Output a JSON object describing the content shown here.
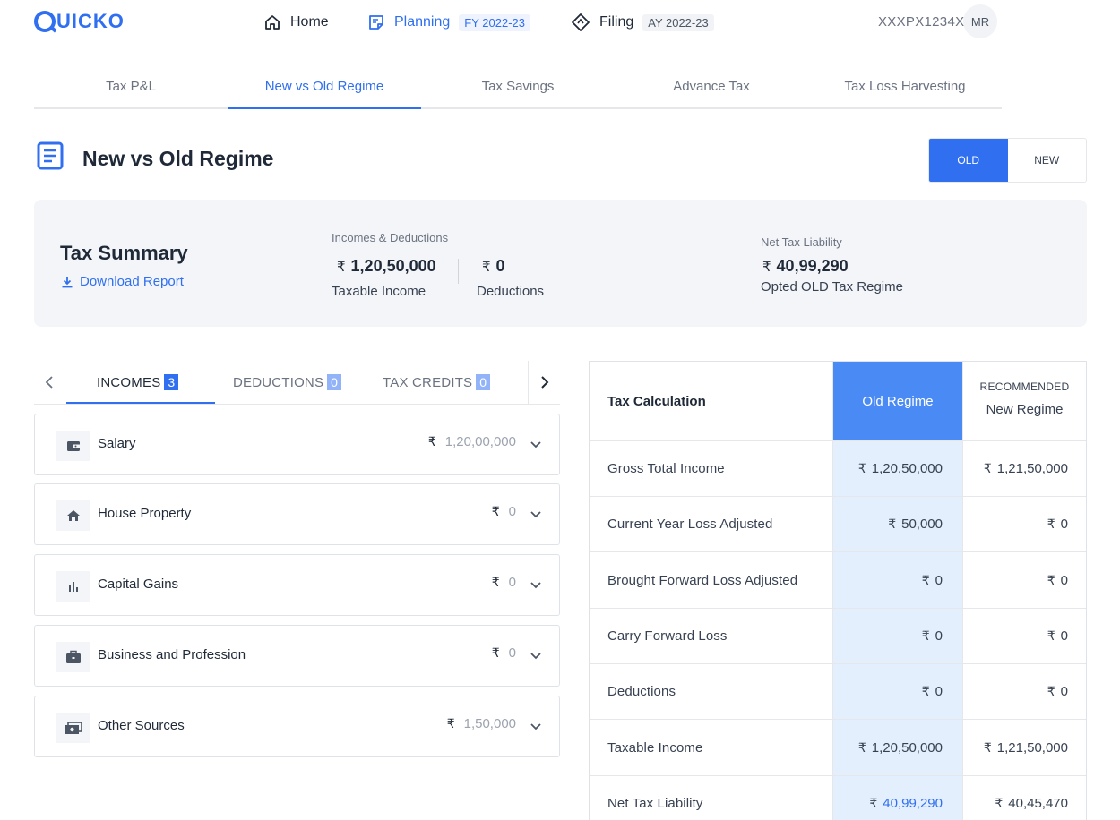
{
  "brand": {
    "logo_text": "UICKO",
    "color": "#2f6ff0"
  },
  "nav": {
    "home": {
      "label": "Home"
    },
    "planning": {
      "label": "Planning",
      "badge": "FY 2022-23"
    },
    "filing": {
      "label": "Filing",
      "badge": "AY 2022-23"
    },
    "pan": "XXXPX1234X",
    "avatar": "MR"
  },
  "top_tabs": [
    "Tax P&L",
    "New vs Old Regime",
    "Tax Savings",
    "Advance Tax",
    "Tax Loss Harvesting"
  ],
  "page": {
    "title": "New vs Old Regime",
    "toggle": {
      "old": "OLD",
      "new": "NEW",
      "selected": "OLD"
    }
  },
  "summary": {
    "title": "Tax Summary",
    "download": "Download Report",
    "incomes_label": "Incomes & Deductions",
    "currency": "₹",
    "taxable_income_value": "1,20,50,000",
    "taxable_income_label": "Taxable Income",
    "deductions_value": "0",
    "deductions_label": "Deductions",
    "liability_label": "Net Tax Liability",
    "liability_value": "40,99,290",
    "liability_sub": "Opted OLD Tax Regime"
  },
  "left_tabs": [
    {
      "label": "INCOMES",
      "count": "3"
    },
    {
      "label": "DEDUCTIONS",
      "count": "0"
    },
    {
      "label": "TAX CREDITS",
      "count": "0"
    }
  ],
  "incomes": [
    {
      "label": "Salary",
      "icon": "wallet-icon",
      "amount": "1,20,00,000"
    },
    {
      "label": "House Property",
      "icon": "home-icon",
      "amount": "0"
    },
    {
      "label": "Capital Gains",
      "icon": "bar-chart-icon",
      "amount": "0"
    },
    {
      "label": "Business and Profession",
      "icon": "briefcase-icon",
      "amount": "0"
    },
    {
      "label": "Other Sources",
      "icon": "cash-icon",
      "amount": "1,50,000"
    }
  ],
  "calc": {
    "title": "Tax Calculation",
    "old_header": "Old Regime",
    "recommended": "RECOMMENDED",
    "new_header": "New Regime",
    "rows": [
      {
        "label": "Gross Total Income",
        "old": "1,20,50,000",
        "new": "1,21,50,000"
      },
      {
        "label": "Current Year Loss Adjusted",
        "old": "50,000",
        "new": "0"
      },
      {
        "label": "Brought Forward Loss Adjusted",
        "old": "0",
        "new": "0"
      },
      {
        "label": "Carry Forward Loss",
        "old": "0",
        "new": "0"
      },
      {
        "label": "Deductions",
        "old": "0",
        "new": "0"
      },
      {
        "label": "Taxable Income",
        "old": "1,20,50,000",
        "new": "1,21,50,000"
      },
      {
        "label": "Net Tax Liability",
        "old": "40,99,290",
        "new": "40,45,470"
      }
    ]
  }
}
